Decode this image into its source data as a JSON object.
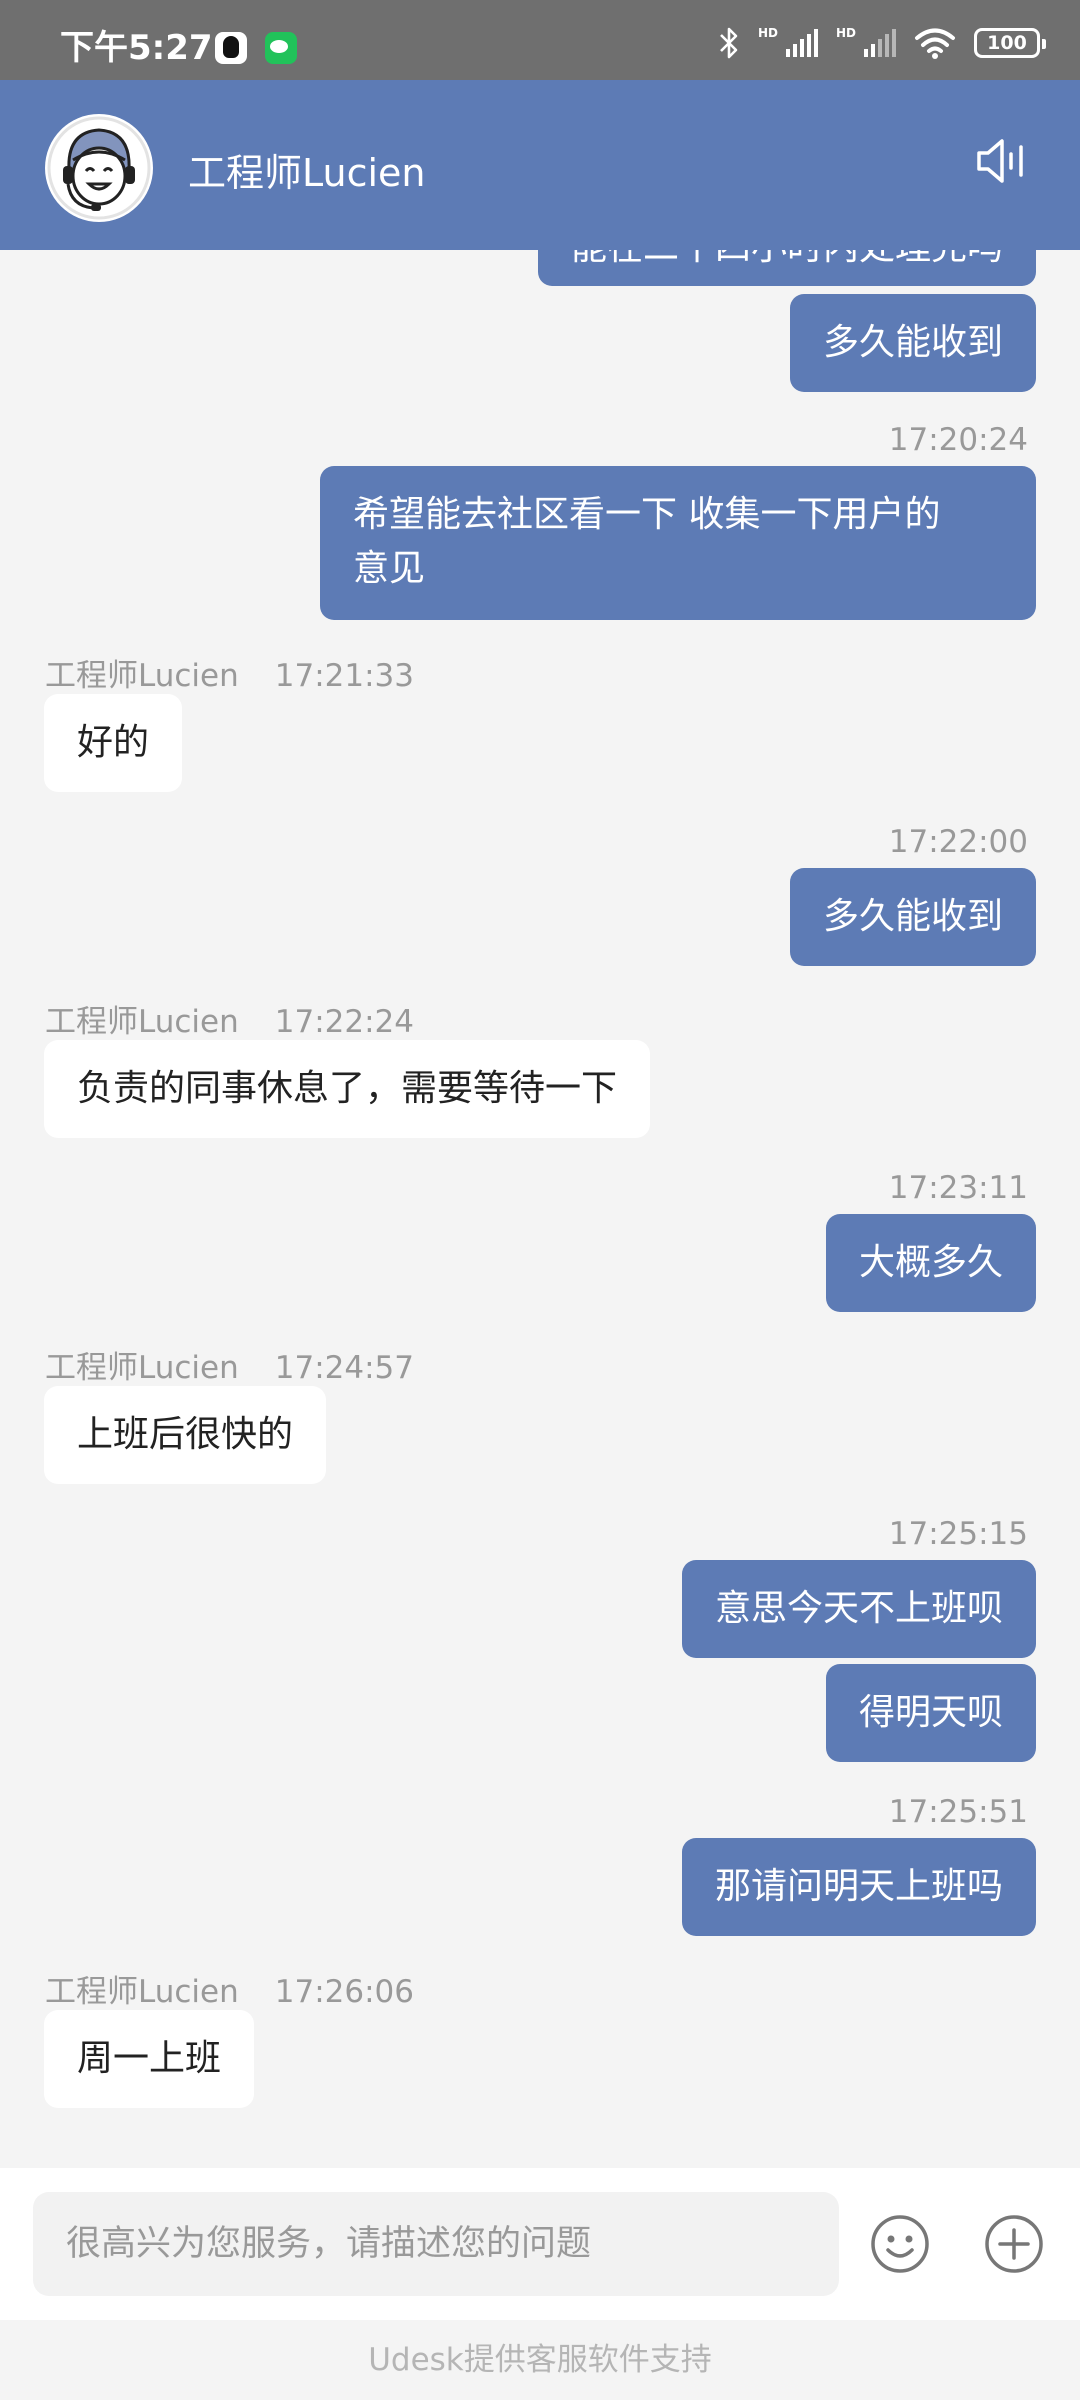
{
  "status_bar": {
    "time": "下午5:27",
    "battery": "100",
    "hd1": "HD",
    "hd2": "HD"
  },
  "header": {
    "title": "工程师Lucien"
  },
  "chat": {
    "m0": "能在二十四小时内处理完吗",
    "m1": "多久能收到",
    "t2": "17:20:24",
    "m2_line1": "希望能去社区看一下 收集一下用户的",
    "m2_line2": "意见",
    "agent_name": "工程师Lucien",
    "t3": "17:21:33",
    "m3": "好的",
    "t4": "17:22:00",
    "m4": "多久能收到",
    "t5": "17:22:24",
    "m5": "负责的同事休息了，需要等待一下",
    "t6": "17:23:11",
    "m6": "大概多久",
    "t7": "17:24:57",
    "m7": "上班后很快的",
    "t8": "17:25:15",
    "m8": "意思今天不上班呗",
    "m9": "得明天呗",
    "t10": "17:25:51",
    "m10": "那请问明天上班吗",
    "t11": "17:26:06",
    "m11": "周一上班"
  },
  "input": {
    "placeholder": "很高兴为您服务，请描述您的问题"
  },
  "footer": {
    "text": "Udesk提供客服软件支持"
  },
  "colors": {
    "header": "#5d7bb5",
    "outgoing_bubble": "#5d7bb5",
    "incoming_bubble": "#ffffff",
    "background": "#f4f4f4"
  }
}
